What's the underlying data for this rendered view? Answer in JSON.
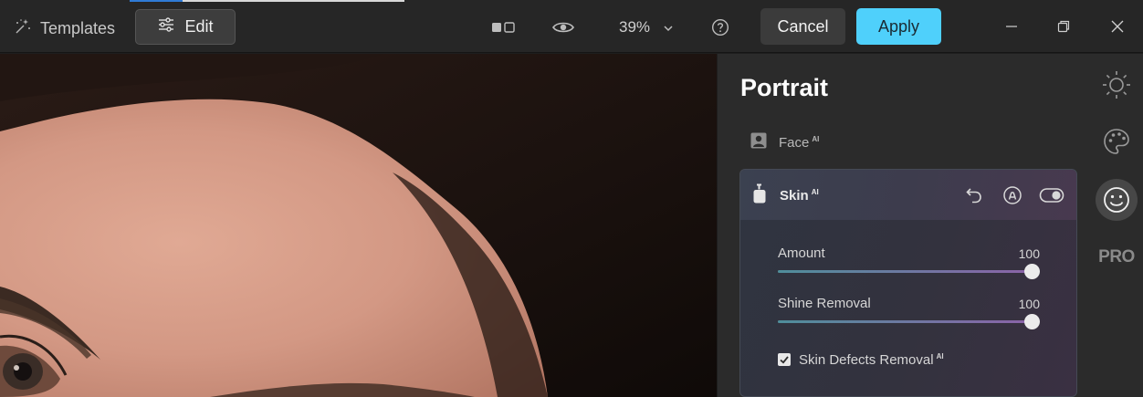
{
  "toolbar": {
    "templates_label": "Templates",
    "edit_label": "Edit",
    "zoom_value": "39%",
    "cancel_label": "Cancel",
    "apply_label": "Apply",
    "apply_color": "#4fd0fb"
  },
  "icons": {
    "templates": "sparkle-icon",
    "edit": "sliders-icon",
    "compare": "split-view-icon",
    "preview": "eye-icon",
    "zoom_dropdown": "chevron-down-icon",
    "help": "help-icon",
    "minimize": "minimize-icon",
    "restore": "restore-icon",
    "close": "close-icon",
    "face": "portrait-icon",
    "skin": "lotion-bottle-icon",
    "reset": "undo-icon",
    "mask": "brush-icon",
    "visibility": "toggle-icon",
    "rail": [
      "sun-icon",
      "palette-icon",
      "smile-icon",
      "pro-icon"
    ]
  },
  "panel": {
    "title": "Portrait",
    "face": {
      "label": "Face",
      "ai_badge": "AI"
    },
    "skin": {
      "label": "Skin",
      "ai_badge": "AI",
      "sliders": [
        {
          "label": "Amount",
          "value": "100",
          "fraction": 1.0
        },
        {
          "label": "Shine Removal",
          "value": "100",
          "fraction": 1.0
        }
      ],
      "checkbox": {
        "label": "Skin Defects Removal",
        "ai_badge": "AI",
        "checked": true
      }
    }
  },
  "rail": {
    "active": "smile-icon",
    "pro_label": "PRO"
  }
}
